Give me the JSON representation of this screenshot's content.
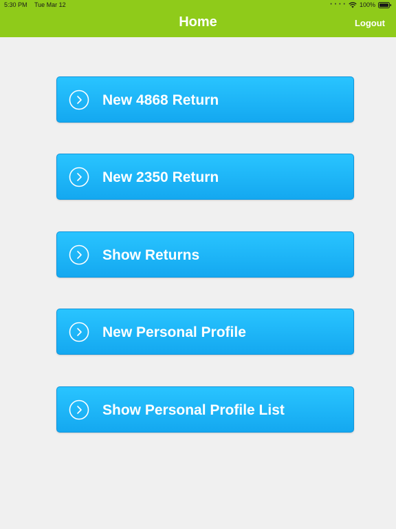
{
  "status_bar": {
    "time": "5:30 PM",
    "date": "Tue Mar 12",
    "battery": "100%",
    "icons": [
      "cellular-dots-icon",
      "wifi-icon",
      "battery-icon"
    ]
  },
  "nav": {
    "title": "Home",
    "logout_label": "Logout"
  },
  "colors": {
    "header_green": "#8fcb1a",
    "button_blue": "#1ab4f7",
    "background": "#f0f0f0"
  },
  "menu": {
    "items": [
      {
        "label": "New 4868 Return",
        "icon": "chevron-right-circle-icon"
      },
      {
        "label": "New 2350 Return",
        "icon": "chevron-right-circle-icon"
      },
      {
        "label": "Show Returns",
        "icon": "chevron-right-circle-icon"
      },
      {
        "label": "New Personal Profile",
        "icon": "chevron-right-circle-icon"
      },
      {
        "label": "Show Personal Profile List",
        "icon": "chevron-right-circle-icon"
      }
    ]
  }
}
